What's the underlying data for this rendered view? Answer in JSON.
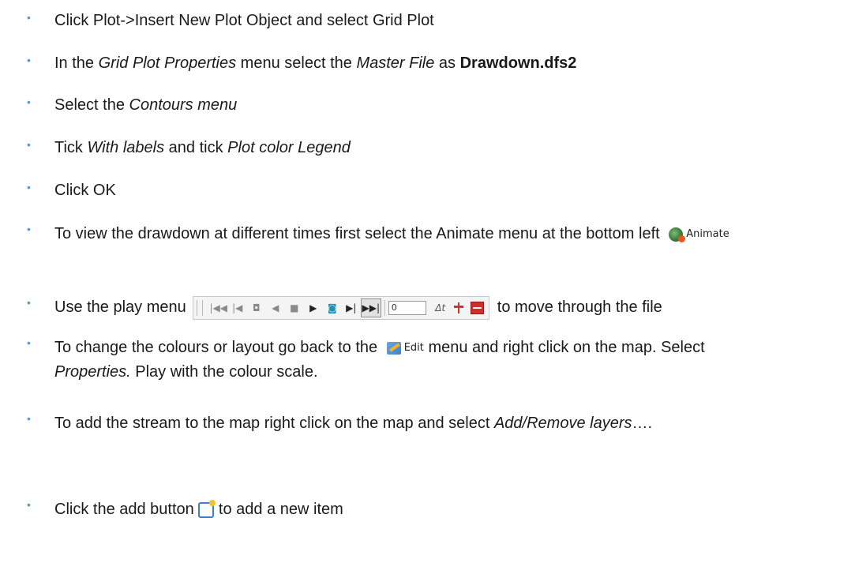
{
  "colors": {
    "bullet": "#4f9ed8",
    "text": "#1a1a1a"
  },
  "steps": {
    "s1": {
      "text": "Click Plot->Insert New Plot Object and select Grid Plot"
    },
    "s2": {
      "a": "In the ",
      "b": "Grid Plot Properties",
      "c": " menu select the ",
      "d": "Master File",
      "e": " as ",
      "f": "Drawdown.dfs2"
    },
    "s3": {
      "a": "Select the ",
      "b": "Contours menu"
    },
    "s4": {
      "a": "Tick ",
      "b": "With labels",
      "c": " and tick ",
      "d": "Plot color Legend"
    },
    "s5": {
      "text": "Click OK"
    },
    "s6": {
      "a": "To view the drawdown at different times first select the Animate menu at the bottom left",
      "button_label": "Animate",
      "icon": "animate-icon"
    },
    "s7": {
      "a": "Use the play menu",
      "b": "to move through the file",
      "frame_value": "0",
      "delta_label": "Δt"
    },
    "s8": {
      "a": "To change the colours or layout go back to the",
      "button_label": "Edit",
      "b": "menu and right click on the map. Select ",
      "c": "Properties.",
      "d": " Play with the colour scale.",
      "icon": "edit-icon"
    },
    "s9": {
      "a": "To add the stream to the map right click on the map and select ",
      "b": "Add/Remove layers",
      "c": "…."
    },
    "s10": {
      "a": "Click the add button",
      "b": "to add a new item",
      "icon": "add-item-icon"
    }
  }
}
